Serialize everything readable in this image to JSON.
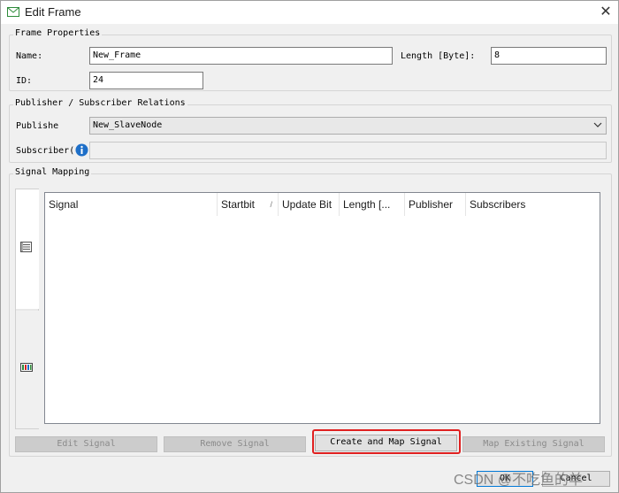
{
  "window": {
    "title": "Edit Frame",
    "close_glyph": "✕"
  },
  "frame_properties": {
    "group_label": "Frame Properties",
    "name_label": "Name:",
    "name_value": "New_Frame",
    "length_label": "Length [Byte]:",
    "length_value": "8",
    "id_label": "ID:",
    "id_value": "24"
  },
  "relations": {
    "group_label": "Publisher / Subscriber Relations",
    "publisher_label": "Publishe",
    "publisher_value": "New_SlaveNode",
    "subscriber_label": "Subscriber(",
    "subscriber_value": ""
  },
  "signal_mapping": {
    "group_label": "Signal Mapping",
    "columns": [
      "Signal",
      "Startbit",
      "Update Bit",
      "Length [...",
      "Publisher",
      "Subscribers"
    ],
    "sort_glyph": "/"
  },
  "buttons": {
    "edit_signal": "Edit Signal",
    "remove_signal": "Remove Signal",
    "create_map": "Create and Map Signal",
    "map_existing": "Map Existing Signal",
    "ok": "OK",
    "cancel": "Cancel"
  },
  "watermark": "CSDN @不吃鱼的羊",
  "colors": {
    "highlight": "#e02020",
    "info_icon": "#1e6fc8",
    "window_bg": "#f0f0f0"
  }
}
